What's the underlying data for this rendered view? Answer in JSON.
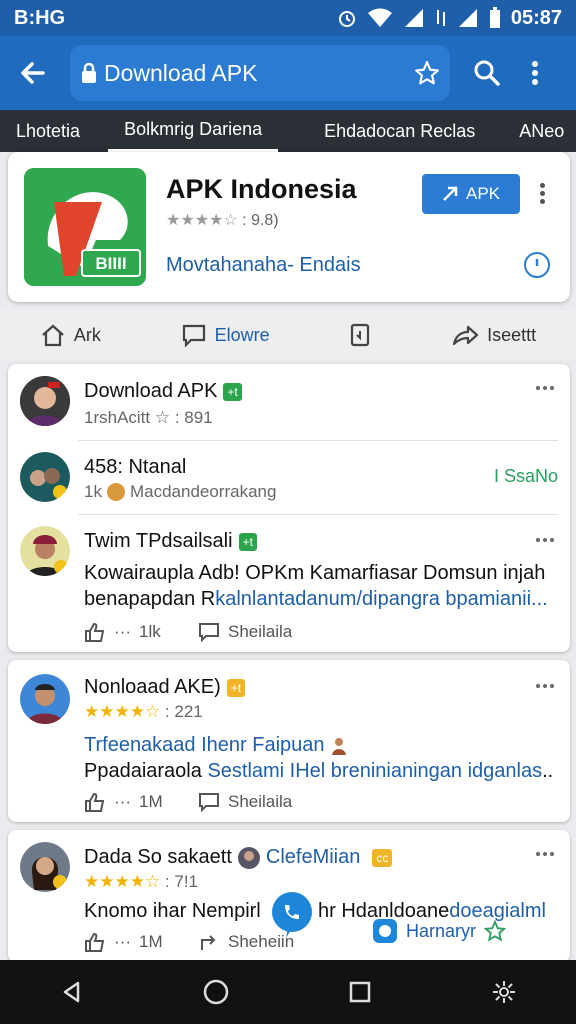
{
  "status": {
    "left": "B:HG",
    "time": "05:87"
  },
  "toolbar": {
    "url": "Download APK"
  },
  "tabs": [
    "Lhotetia",
    "Bolkmrig Dariena",
    "Ehdadocan Reclas",
    "ANeo"
  ],
  "app": {
    "title": "APK Indonesia",
    "rating": "9.8)",
    "subtitle": "Movtahanaha- Endais",
    "button_label": "APK",
    "icon_text": "BIIII",
    "colors": {
      "icon_green": "#2fa84f",
      "accent_red": "#e0452b",
      "brand_blue": "#1f6bbd"
    }
  },
  "actions": [
    {
      "label": "Ark",
      "icon": "home-icon"
    },
    {
      "label": "Elowre",
      "icon": "chat-icon"
    },
    {
      "label": "",
      "icon": "bookmark-icon"
    },
    {
      "label": "Iseettt",
      "icon": "share-icon"
    }
  ],
  "posts": [
    {
      "name": "Download APK",
      "badge": "+t",
      "meta": "1rshAcitt ☆ : 891"
    },
    {
      "name": "458: Ntanal",
      "meta_prefix": "1k",
      "meta": "Macdandeorrakang",
      "side_label": "I SsaNo"
    },
    {
      "name": "Twim TPdsailsali",
      "badge": "+t",
      "line1": "Kowairaupla Adb! OPKm Kamarfiasar Domsun injah",
      "line2_black": "benapapdan R",
      "line2_blue": "kalnlantadanum/dipangra bpamianii...",
      "likes": "1lk",
      "share": "Sheilaila"
    },
    {
      "name": "Nonloaad AKE)",
      "badge": "+t",
      "rating": "221",
      "line1": "Trfeenakaad Ihenr Faipuan",
      "line2_black": "Ppadaiaraola ",
      "line2_blue": "Sestlami IHel breninianingan idganlas",
      "line2_end": "..",
      "likes": "1M",
      "share": "Sheilaila"
    },
    {
      "name": "Dada So sakaett",
      "name_blue": "ClefeMiian",
      "badge": "cc",
      "rating": "7!1",
      "line1": "Knomo",
      "line1_b": " ihar Nempirl",
      "line1_c": "hr Hdanldoane",
      "line1_d": "doeagialml",
      "likes": "1M",
      "share": "Sheheiin",
      "side_label": "Harnaryr"
    }
  ],
  "nav": [
    "back-icon",
    "home-circle-icon",
    "recents-icon",
    "settings-icon"
  ]
}
